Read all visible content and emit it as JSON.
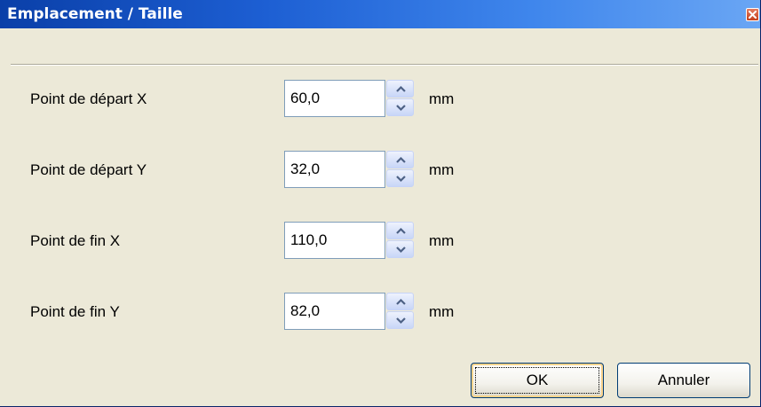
{
  "window": {
    "title": "Emplacement / Taille",
    "close_icon": "close-icon"
  },
  "fields": [
    {
      "label": "Point de départ X",
      "value": "60,0",
      "unit": "mm"
    },
    {
      "label": "Point de départ Y",
      "value": "32,0",
      "unit": "mm"
    },
    {
      "label": "Point de fin X",
      "value": "110,0",
      "unit": "mm"
    },
    {
      "label": "Point de fin Y",
      "value": "82,0",
      "unit": "mm"
    }
  ],
  "buttons": {
    "ok_label": "OK",
    "cancel_label": "Annuler"
  },
  "colors": {
    "titlebar_start": "#0a3fa8",
    "titlebar_end": "#6aa6f4",
    "dialog_background": "#ece9d8",
    "close_button": "#c4401d"
  }
}
